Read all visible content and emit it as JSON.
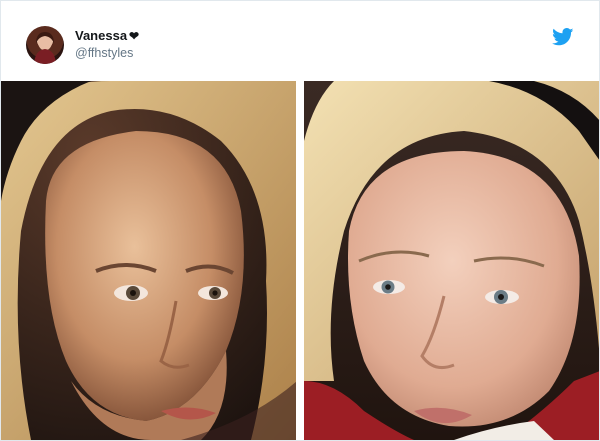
{
  "tweet": {
    "author": {
      "display_name": "Vanessa",
      "name_emoji": "❤",
      "handle": "@ffhstyles"
    },
    "brand": {
      "icon": "twitter-bird-icon",
      "color": "#1da1f2"
    },
    "media": [
      {
        "icon": "photo-left-portrait"
      },
      {
        "icon": "photo-right-portrait"
      }
    ]
  }
}
